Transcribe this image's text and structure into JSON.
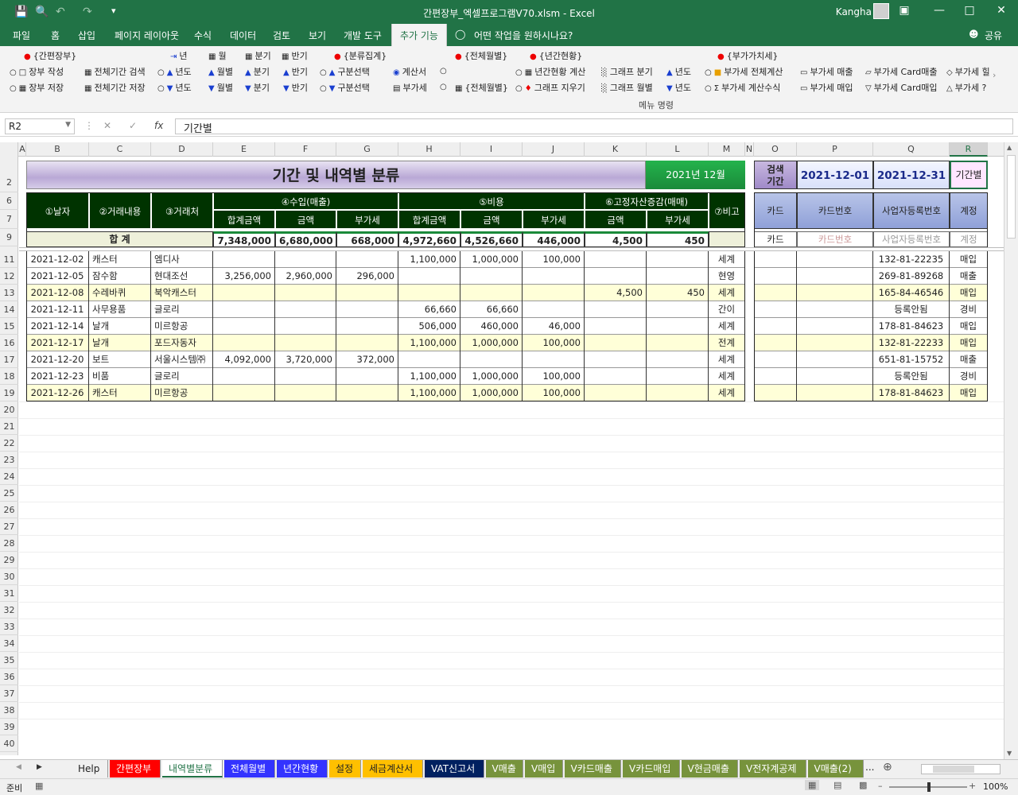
{
  "window": {
    "title": "간편장부_엑셀프로그램V70.xlsm  -  Excel",
    "user": "Kangha",
    "share": "공유",
    "tell_me": "어떤 작업을 원하시나요?"
  },
  "ribbon_tabs": [
    "파일",
    "홈",
    "삽입",
    "페이지 레이아웃",
    "수식",
    "데이터",
    "검토",
    "보기",
    "개발 도구",
    "추가 기능"
  ],
  "ribbon": {
    "g1": {
      "title": "{간편장부}",
      "item1": "장부 작성",
      "item2": "장부 저장",
      "item3": "전체기간 검색",
      "item4": "전체기간 저장"
    },
    "g2": {
      "h1": "년",
      "h2": "월",
      "h3": "분기",
      "h4": "반기",
      "r1a": "년도",
      "r1b": "월별",
      "r1c": "분기",
      "r1d": "반기",
      "r2a": "년도",
      "r2b": "월별",
      "r2c": "분기",
      "r2d": "반기"
    },
    "g3": {
      "title": "{분류집계}",
      "r1": "구분선택",
      "r2": "구분선택",
      "b1": "계산서",
      "b2": "부가세"
    },
    "g4": {
      "title": "{전체월별}",
      "r2": "{전체월별}"
    },
    "g5": {
      "title": "{년간현황}",
      "r1": "년간현황 계산",
      "r2": "그래프 지우기",
      "r1b": "그래프 분기",
      "r2b": "그래프 월별",
      "r1c": "년도",
      "r2c": "년도"
    },
    "g6": {
      "title": "{부가가치세}",
      "r1a": "부가세 전체계산",
      "r1b": "부가세 매출",
      "r1c": "부가세 Card매출",
      "r1d": "부가세 힐",
      "r2a": "부가세 계산수식",
      "r2b": "부가세 매입",
      "r2c": "부가세 Card매입",
      "r2d": "부가세 ?"
    },
    "caption": "메뉴 명령"
  },
  "formula_bar": {
    "name_box": "R2",
    "fx": "fx",
    "value": "기간별"
  },
  "columns": [
    "A",
    "B",
    "C",
    "D",
    "E",
    "F",
    "G",
    "H",
    "I",
    "J",
    "K",
    "L",
    "M",
    "N",
    "O",
    "P",
    "Q",
    "R"
  ],
  "rows": [
    "1",
    "2",
    "6",
    "7",
    "9",
    "11",
    "12",
    "13",
    "14",
    "15",
    "16",
    "17",
    "18",
    "19",
    "20",
    "21",
    "22",
    "23",
    "24",
    "25",
    "26",
    "27",
    "28",
    "29",
    "30",
    "31",
    "32",
    "33",
    "34",
    "35",
    "36",
    "37",
    "38",
    "39",
    "40"
  ],
  "sheet": {
    "title": "기간 및 내역별 분류",
    "period_badge": "2021년 12월",
    "search_label": "검색\n기간",
    "date_from": "2021-12-01",
    "date_to": "2021-12-31",
    "mode": "기간별",
    "headers": {
      "date": "①날자",
      "desc": "②거래내용",
      "vendor": "③거래처",
      "income": "④수입(매출)",
      "expense": "⑤비용",
      "asset": "⑥고정자산증감(매매)",
      "note": "⑦비고",
      "total_amt": "합계금액",
      "amt": "금액",
      "vat": "부가세"
    },
    "side_headers": [
      "카드",
      "카드번호",
      "사업자등록번호",
      "계정"
    ],
    "sum_label": "합        계",
    "sums": [
      "7,348,000",
      "6,680,000",
      "668,000",
      "4,972,660",
      "4,526,660",
      "446,000",
      "4,500",
      "450"
    ],
    "side_sum": [
      "카드",
      "카드번호",
      "사업자등록번호",
      "계정"
    ],
    "rows": [
      [
        "2021-12-02",
        "캐스터",
        "엠디사",
        "",
        "",
        "",
        "1,100,000",
        "1,000,000",
        "100,000",
        "",
        "",
        "세계",
        "",
        "",
        "132-81-22235",
        "매입"
      ],
      [
        "2021-12-05",
        "잠수함",
        "현대조선",
        "3,256,000",
        "2,960,000",
        "296,000",
        "",
        "",
        "",
        "",
        "",
        "현영",
        "",
        "",
        "269-81-89268",
        "매출"
      ],
      [
        "2021-12-08",
        "수레바퀴",
        "북악캐스터",
        "",
        "",
        "",
        "",
        "",
        "",
        "4,500",
        "450",
        "세계",
        "",
        "",
        "165-84-46546",
        "매입"
      ],
      [
        "2021-12-11",
        "사무용품",
        "글로리",
        "",
        "",
        "",
        "66,660",
        "66,660",
        "",
        "",
        "",
        "간이",
        "",
        "",
        "등록안됨",
        "경비"
      ],
      [
        "2021-12-14",
        "날개",
        "미르항공",
        "",
        "",
        "",
        "506,000",
        "460,000",
        "46,000",
        "",
        "",
        "세계",
        "",
        "",
        "178-81-84623",
        "매입"
      ],
      [
        "2021-12-17",
        "날개",
        "포드자동자",
        "",
        "",
        "",
        "1,100,000",
        "1,000,000",
        "100,000",
        "",
        "",
        "전계",
        "",
        "",
        "132-81-22233",
        "매입"
      ],
      [
        "2021-12-20",
        "보트",
        "서울시스템㈜",
        "4,092,000",
        "3,720,000",
        "372,000",
        "",
        "",
        "",
        "",
        "",
        "세계",
        "",
        "",
        "651-81-15752",
        "매출"
      ],
      [
        "2021-12-23",
        "비품",
        "글로리",
        "",
        "",
        "",
        "1,100,000",
        "1,000,000",
        "100,000",
        "",
        "",
        "세계",
        "",
        "",
        "등록안됨",
        "경비"
      ],
      [
        "2021-12-26",
        "캐스터",
        "미르항공",
        "",
        "",
        "",
        "1,100,000",
        "1,000,000",
        "100,000",
        "",
        "",
        "세계",
        "",
        "",
        "178-81-84623",
        "매입"
      ]
    ]
  },
  "sheet_tabs": [
    {
      "label": "Help",
      "bg": "#f0f0f0",
      "fg": "#222"
    },
    {
      "label": "간편장부",
      "bg": "#ff0000",
      "fg": "#fff"
    },
    {
      "label": "내역별분류",
      "bg": "#ffffff",
      "fg": "#217346"
    },
    {
      "label": "전체월별",
      "bg": "#3333ff",
      "fg": "#fff"
    },
    {
      "label": "년간현황",
      "bg": "#3333ff",
      "fg": "#fff"
    },
    {
      "label": "설정",
      "bg": "#ffc000",
      "fg": "#222"
    },
    {
      "label": "세금계산서",
      "bg": "#ffc000",
      "fg": "#222"
    },
    {
      "label": "VAT신고서",
      "bg": "#002060",
      "fg": "#fff"
    },
    {
      "label": "V매출",
      "bg": "#77933c",
      "fg": "#fff"
    },
    {
      "label": "V매입",
      "bg": "#77933c",
      "fg": "#fff"
    },
    {
      "label": "V카드매출",
      "bg": "#77933c",
      "fg": "#fff"
    },
    {
      "label": "V카드매입",
      "bg": "#77933c",
      "fg": "#fff"
    },
    {
      "label": "V현금매출",
      "bg": "#77933c",
      "fg": "#fff"
    },
    {
      "label": "V전자계공제",
      "bg": "#77933c",
      "fg": "#fff"
    },
    {
      "label": "V매출(2)",
      "bg": "#77933c",
      "fg": "#fff"
    }
  ],
  "status": {
    "ready": "준비",
    "zoom": "100%",
    "more": "..."
  }
}
